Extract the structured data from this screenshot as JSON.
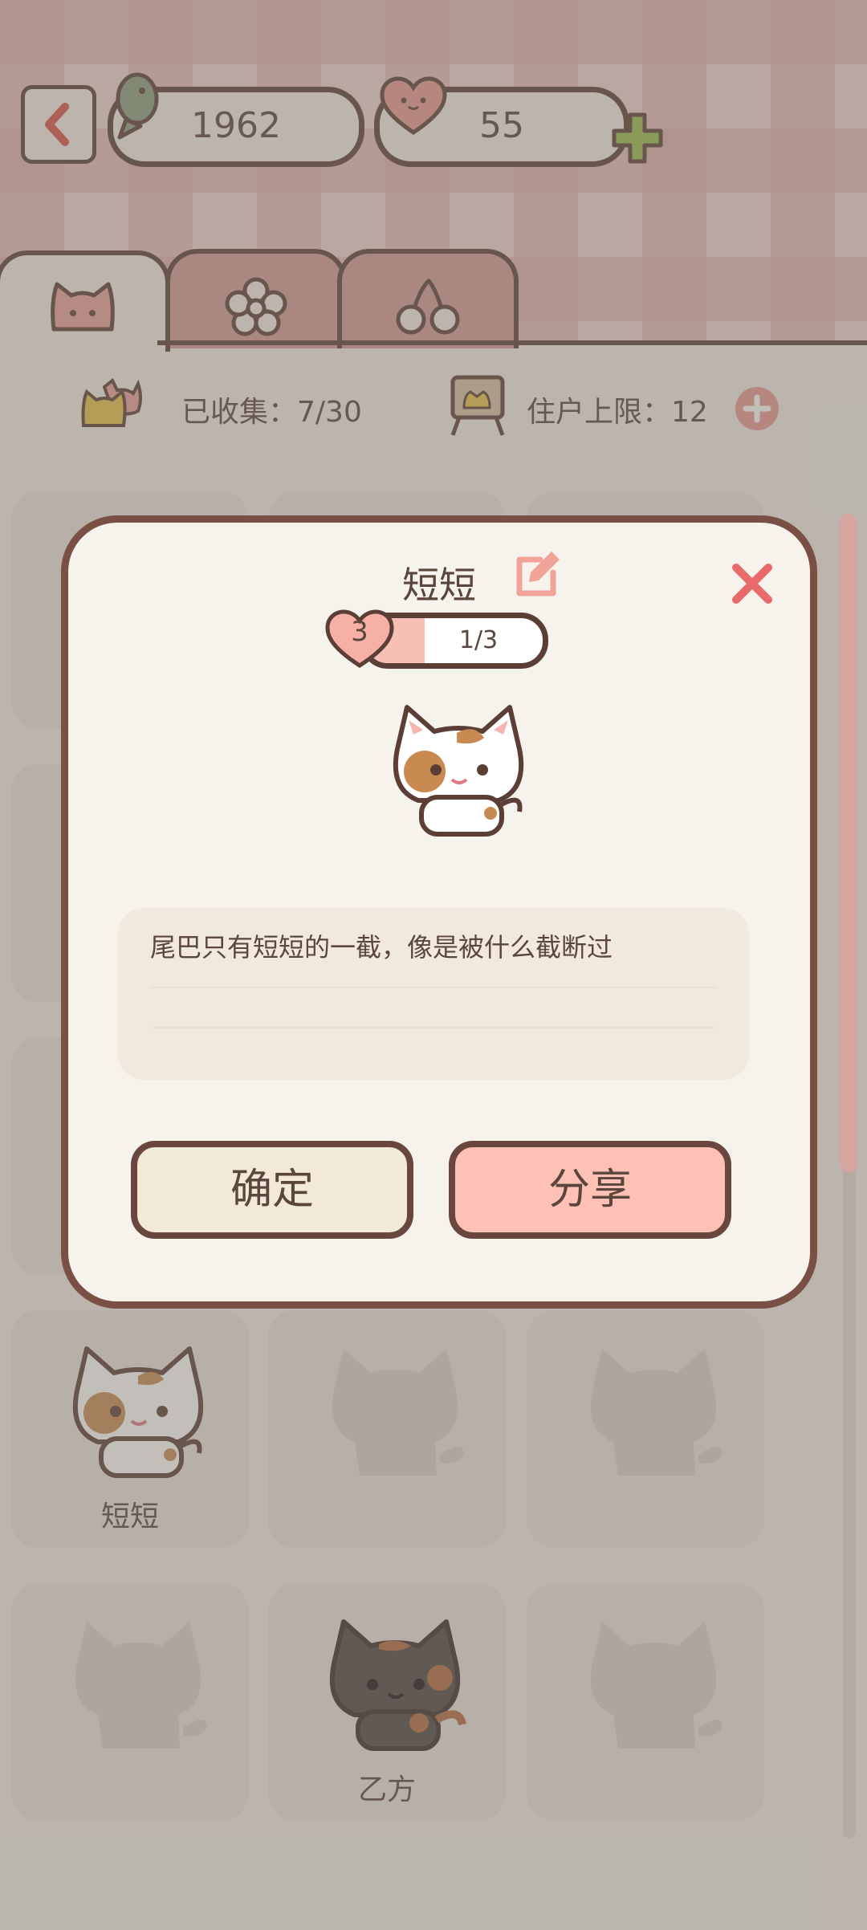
{
  "header": {
    "fish_count": "1962",
    "heart_count": "55"
  },
  "tabs": [
    {
      "icon": "cat-face-icon"
    },
    {
      "icon": "flower-icon"
    },
    {
      "icon": "cherry-icon"
    }
  ],
  "stats": {
    "collected": "已收集：7/30",
    "resident_limit": "住户上限：12"
  },
  "grid": {
    "cells": [
      {
        "name": "短短",
        "unlocked": true
      },
      {
        "name": "",
        "unlocked": false
      },
      {
        "name": "",
        "unlocked": false
      },
      {
        "name": "",
        "unlocked": false
      },
      {
        "name": "乙方",
        "unlocked": true
      },
      {
        "name": "",
        "unlocked": false
      }
    ]
  },
  "dialog": {
    "cat_name": "短短",
    "level": "3",
    "progress_text": "1/3",
    "progress": 0.33,
    "description": "尾巴只有短短的一截，像是被什么截断过",
    "ok_label": "确定",
    "share_label": "分享"
  },
  "colors": {
    "brown_outline": "#5b3f36",
    "accent_pink": "#ffc1b5",
    "close_red": "#e86a6a",
    "plus_green": "#8fb04a"
  }
}
